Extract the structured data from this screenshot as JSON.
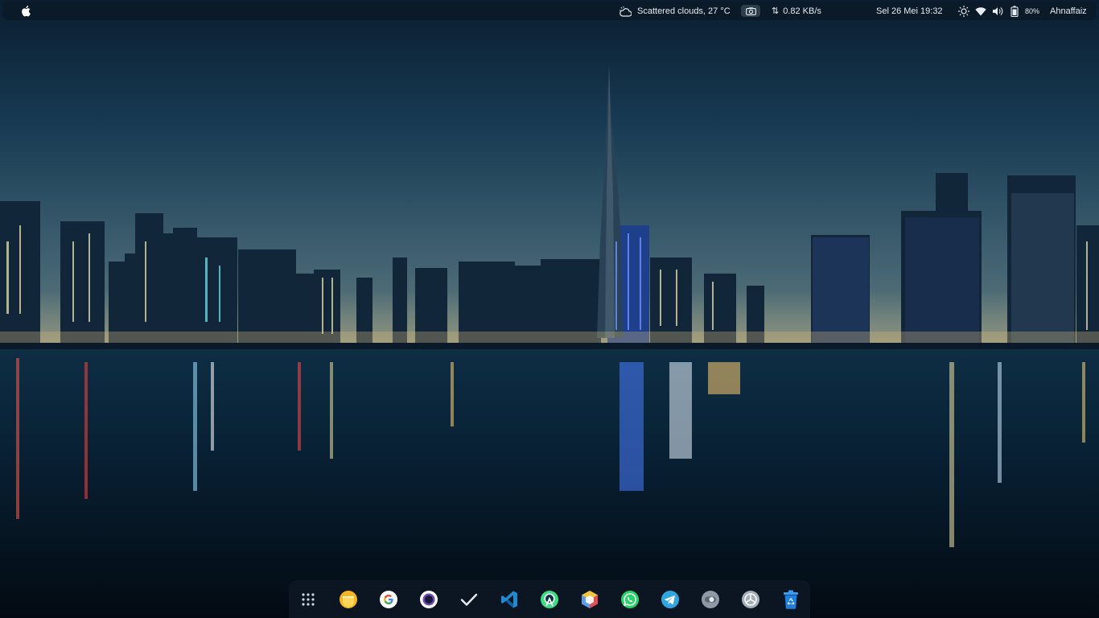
{
  "topbar": {
    "apple_menu_icon": "apple-logo-icon",
    "weather": {
      "icon": "weather-icon",
      "text": "Scattered clouds, 27 °C"
    },
    "screenshot_icon": "camera-icon",
    "network": {
      "icon": "updown-arrows-icon",
      "speed": "0.82 KB/s"
    },
    "clock": "Sel 26 Mei 19:32",
    "tray": {
      "icons": [
        "brightness-icon",
        "wifi-icon",
        "volume-icon",
        "battery-icon"
      ],
      "battery_percent": "80%"
    },
    "user": "Ahnaffaiz"
  },
  "dock": {
    "items": [
      {
        "name": "app-launcher",
        "icon": "grid-icon"
      },
      {
        "name": "files",
        "icon": "files-icon"
      },
      {
        "name": "google-chrome",
        "icon": "google-icon"
      },
      {
        "name": "screen-recorder",
        "icon": "record-icon"
      },
      {
        "name": "tasks",
        "icon": "checkmark-icon"
      },
      {
        "name": "vs-code",
        "icon": "vscode-icon"
      },
      {
        "name": "android-studio",
        "icon": "android-studio-icon"
      },
      {
        "name": "virtualbox",
        "icon": "cube-icon"
      },
      {
        "name": "whatsapp",
        "icon": "whatsapp-icon"
      },
      {
        "name": "telegram",
        "icon": "telegram-icon"
      },
      {
        "name": "toggle-app",
        "icon": "toggle-icon"
      },
      {
        "name": "system-settings",
        "icon": "settings-icon"
      },
      {
        "name": "trash",
        "icon": "trash-icon"
      }
    ]
  },
  "colors": {
    "panel_bg": "#0a1a29",
    "dock_bg": "#0b1622",
    "sky_top": "#0c2034",
    "sky_horizon": "#4c6a7a",
    "water": "#061624"
  }
}
